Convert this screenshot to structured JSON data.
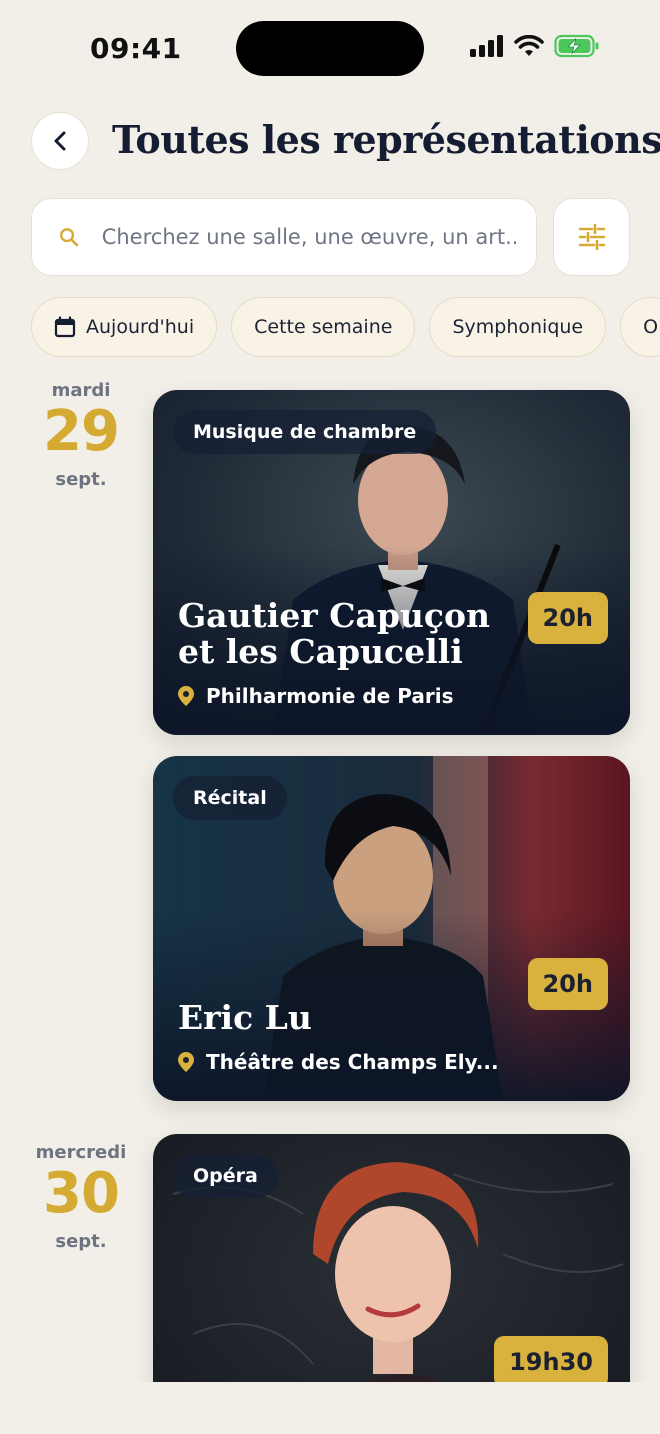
{
  "status": {
    "time": "09:41"
  },
  "header": {
    "title": "Toutes les représentations"
  },
  "search": {
    "placeholder": "Cherchez une salle, une œuvre, un art..."
  },
  "chips": [
    {
      "label": "Aujourd'hui",
      "icon": "calendar-icon"
    },
    {
      "label": "Cette semaine"
    },
    {
      "label": "Symphonique"
    },
    {
      "label": "O"
    }
  ],
  "days": [
    {
      "weekday": "mardi",
      "day": "29",
      "month": "sept.",
      "events": [
        {
          "tag": "Musique de chambre",
          "title": "Gautier Capuçon et les Capucelli",
          "venue": "Philharmonie de Paris",
          "time": "20h"
        },
        {
          "tag": "Récital",
          "title": "Eric Lu",
          "venue": "Théâtre des Champs Ely...",
          "time": "20h"
        }
      ]
    },
    {
      "weekday": "mercredi",
      "day": "30",
      "month": "sept.",
      "events": [
        {
          "tag": "Opéra",
          "time": "19h30"
        }
      ]
    }
  ],
  "colors": {
    "background": "#f2efe8",
    "accent": "#d5aa32",
    "navy": "#151d33"
  }
}
